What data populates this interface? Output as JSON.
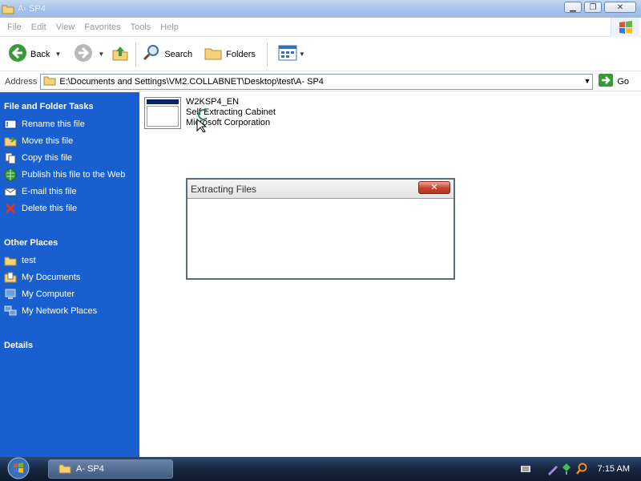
{
  "window": {
    "title": "A- SP4",
    "controls": [
      "minimize",
      "maximize",
      "close"
    ]
  },
  "menubar": {
    "items": [
      "File",
      "Edit",
      "View",
      "Favorites",
      "Tools",
      "Help"
    ]
  },
  "toolbar": {
    "back_label": "Back",
    "search_label": "Search",
    "folders_label": "Folders"
  },
  "address": {
    "label": "Address",
    "path": "E:\\Documents and Settings\\VM2.COLLABNET\\Desktop\\test\\A- SP4",
    "go_label": "Go"
  },
  "tasks": {
    "file_folder_title": "File and Folder Tasks",
    "items": [
      {
        "label": "Rename this file",
        "icon": "rename-icon"
      },
      {
        "label": "Move this file",
        "icon": "move-icon"
      },
      {
        "label": "Copy this file",
        "icon": "copy-icon"
      },
      {
        "label": "Publish this file to the Web",
        "icon": "publish-web-icon"
      },
      {
        "label": "E-mail this file",
        "icon": "email-icon"
      },
      {
        "label": "Delete this file",
        "icon": "delete-icon"
      }
    ],
    "other_places_title": "Other Places",
    "places": [
      {
        "label": "test",
        "icon": "folder-icon"
      },
      {
        "label": "My Documents",
        "icon": "my-documents-icon"
      },
      {
        "label": "My Computer",
        "icon": "my-computer-icon"
      },
      {
        "label": "My Network Places",
        "icon": "network-places-icon"
      }
    ],
    "details_title": "Details"
  },
  "file": {
    "name": "W2KSP4_EN",
    "type": "Self Extracting Cabinet",
    "company": "Microsoft Corporation"
  },
  "dialog": {
    "title": "Extracting Files"
  },
  "taskbar": {
    "task_label": "A- SP4",
    "clock": "7:15 AM"
  },
  "colors": {
    "task_pane": "#1a5fd0",
    "taskbar": "#17263f",
    "close_button": "#c7412b"
  }
}
